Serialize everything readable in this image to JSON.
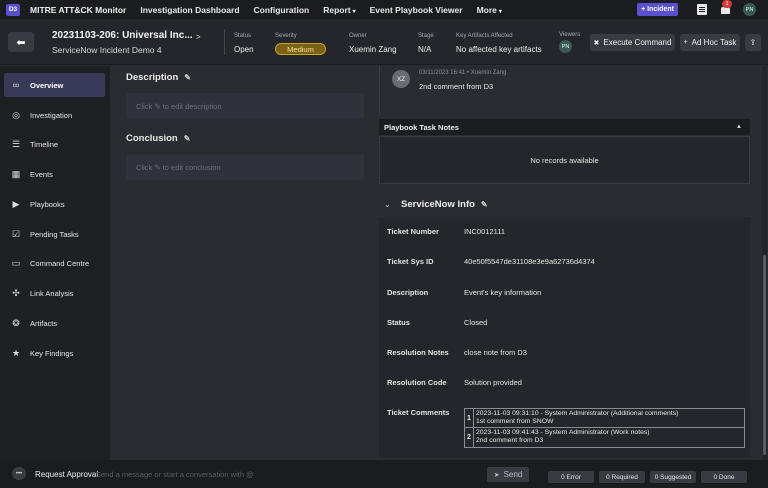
{
  "nav": {
    "logo": "D3",
    "brand": "MITRE ATT&CK Monitor",
    "items": [
      {
        "label": "Investigation Dashboard",
        "caret": ""
      },
      {
        "label": "Configuration",
        "caret": ""
      },
      {
        "label": "Report",
        "caret": "▾"
      },
      {
        "label": "Event Playbook Viewer",
        "caret": ""
      },
      {
        "label": "More",
        "caret": "▾"
      }
    ],
    "incident_button": "+ Incident",
    "notification_count": "1",
    "user_initials": "PN"
  },
  "header": {
    "back_glyph": "⬅",
    "title": "20231103-206: Universal Inc...",
    "subtitle": "ServiceNow Incident Demo 4",
    "share_glyph": "❮",
    "status_label": "Status",
    "status_value": "Open",
    "severity_label": "Severity",
    "severity_value": "Medium",
    "owner_label": "Owner",
    "owner_value": "Xuemin Zang",
    "stage_label": "Stage",
    "stage_value": "N/A",
    "artifacts_label": "Key Artifacts Affected",
    "artifacts_value": "No affected key artifacts",
    "viewers_label": "Viewers",
    "viewer_initials": "PN",
    "execute_label": "Execute Command",
    "adhoc_label": "Ad Hoc Task"
  },
  "sidebar": {
    "items": [
      {
        "label": "Overview",
        "icon": "binoculars-icon",
        "glyph": "∞"
      },
      {
        "label": "Investigation",
        "icon": "target-icon",
        "glyph": "◎"
      },
      {
        "label": "Timeline",
        "icon": "timeline-icon",
        "glyph": "☰"
      },
      {
        "label": "Events",
        "icon": "calendar-icon",
        "glyph": "▦"
      },
      {
        "label": "Playbooks",
        "icon": "playbook-icon",
        "glyph": "▶"
      },
      {
        "label": "Pending Tasks",
        "icon": "checklist-icon",
        "glyph": "☑"
      },
      {
        "label": "Command Centre",
        "icon": "terminal-icon",
        "glyph": "▭"
      },
      {
        "label": "Link Analysis",
        "icon": "network-icon",
        "glyph": "✣"
      },
      {
        "label": "Artifacts",
        "icon": "fingerprint-icon",
        "glyph": "❂"
      },
      {
        "label": "Key Findings",
        "icon": "star-icon",
        "glyph": "★"
      }
    ]
  },
  "description": {
    "heading": "Description",
    "placeholder": "Click ✎ to edit description"
  },
  "conclusion": {
    "heading": "Conclusion",
    "placeholder": "Click ✎ to edit conclusion"
  },
  "comment": {
    "initials": "XZ",
    "meta": "03/11/2023 16:41  •  Xuemin Zang",
    "text": "2nd comment from D3"
  },
  "playbook_notes": {
    "heading": "Playbook Task Notes",
    "empty": "No records available"
  },
  "servicenow": {
    "heading": "ServiceNow Info",
    "rows": [
      {
        "label": "Ticket Number",
        "value": "INC0012111"
      },
      {
        "label": "Ticket Sys ID",
        "value": "40e50f5547de31108e3e9a62736d4374"
      },
      {
        "label": "Description",
        "value": "Event's key information"
      },
      {
        "label": "Status",
        "value": "Closed"
      },
      {
        "label": "Resolution Notes",
        "value": "close note from D3"
      },
      {
        "label": "Resolution Code",
        "value": "Solution provided"
      },
      {
        "label": "Ticket Comments",
        "value": ""
      }
    ],
    "comments": [
      {
        "num": "1",
        "line1": "2023-11-03 09:31:10 - System Administrator (Additional comments)",
        "line2": "1st comment from SNOW"
      },
      {
        "num": "2",
        "line1": "2023-11-03 09:41:43 - System Administrator (Work notes)",
        "line2": "2nd comment from D3"
      }
    ]
  },
  "bottom": {
    "request_label": "Request Approval",
    "message_placeholder": "Send a message or start a conversation with @",
    "send_label": "Send",
    "error": "0 Error",
    "required": "0 Required",
    "suggested": "0 Suggested",
    "done": "0 Done"
  },
  "colors": {
    "accent": "#5a4fcf",
    "severity_medium": "#c9a22a",
    "active_sidebar": "#383a58"
  }
}
